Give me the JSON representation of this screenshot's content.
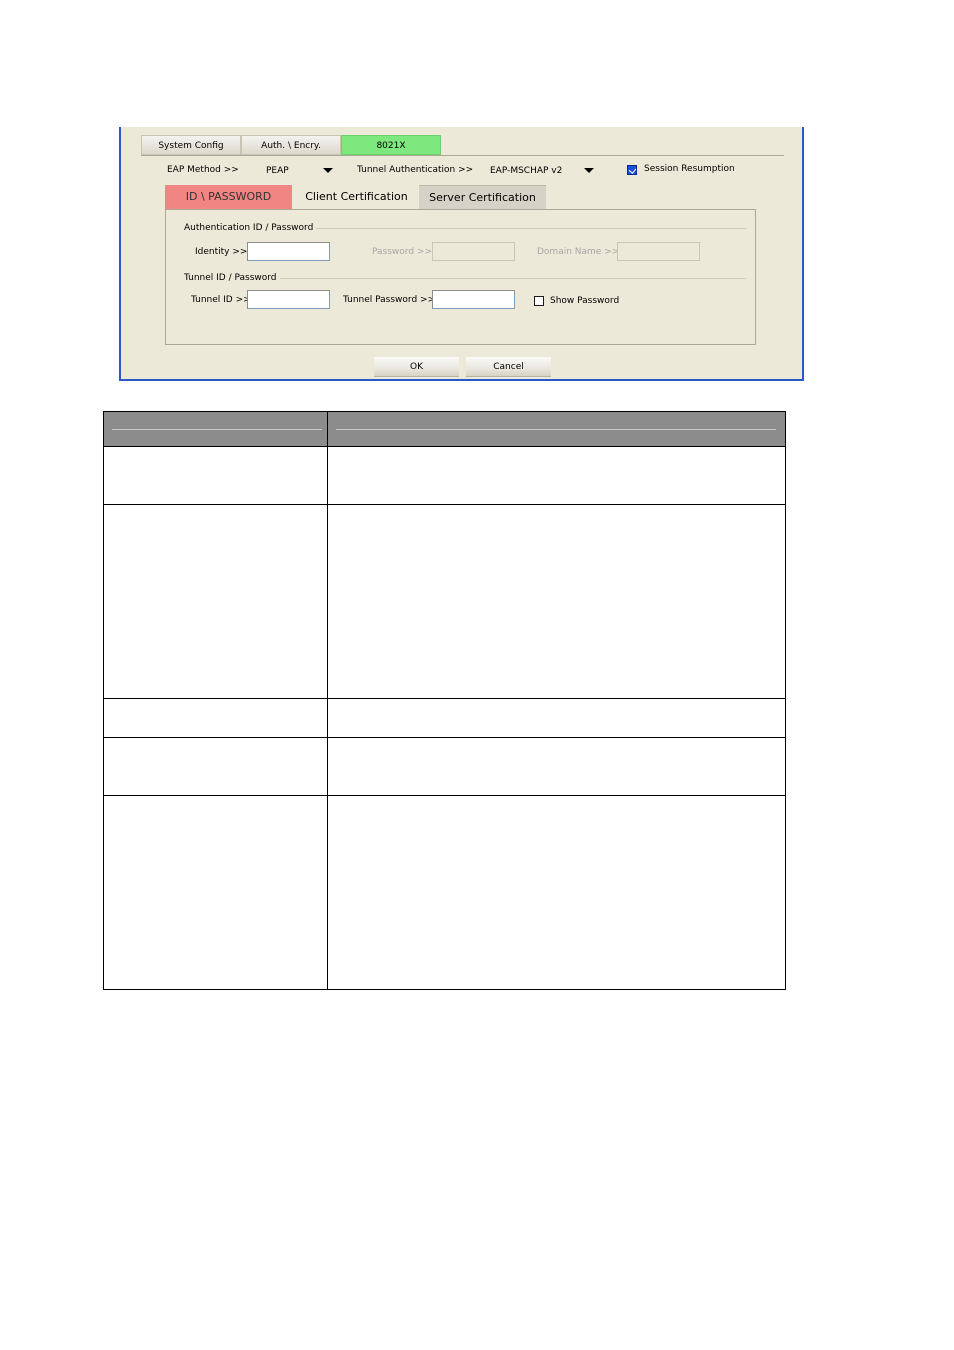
{
  "dialog": {
    "main_tabs": [
      {
        "label": "System Config"
      },
      {
        "label": "Auth. \\ Encry."
      },
      {
        "label": "8021X"
      }
    ],
    "eap_method": {
      "label": "EAP Method >>",
      "value": "PEAP"
    },
    "tunnel_auth": {
      "label": "Tunnel Authentication >>",
      "value": "EAP-MSCHAP v2"
    },
    "session_resumption": {
      "label": "Session Resumption",
      "checked": true
    },
    "sub_tabs": [
      {
        "label": "ID \\ PASSWORD"
      },
      {
        "label": "Client Certification"
      },
      {
        "label": "Server Certification"
      }
    ],
    "auth_group": {
      "title": "Authentication ID / Password",
      "identity_label": "Identity >>",
      "identity_value": "",
      "password_label": "Password >>",
      "password_value": "",
      "domain_label": "Domain Name >>",
      "domain_value": ""
    },
    "tunnel_group": {
      "title": "Tunnel ID / Password",
      "tunnel_id_label": "Tunnel ID >>",
      "tunnel_id_value": "",
      "tunnel_password_label": "Tunnel Password >>",
      "tunnel_password_value": "",
      "show_password_label": "Show Password",
      "show_password_checked": false
    },
    "buttons": {
      "ok": "OK",
      "cancel": "Cancel"
    },
    "colors": {
      "active_tab": "#7ee77e",
      "active_subtab": "#f08583",
      "frame": "#2b57c9"
    }
  }
}
